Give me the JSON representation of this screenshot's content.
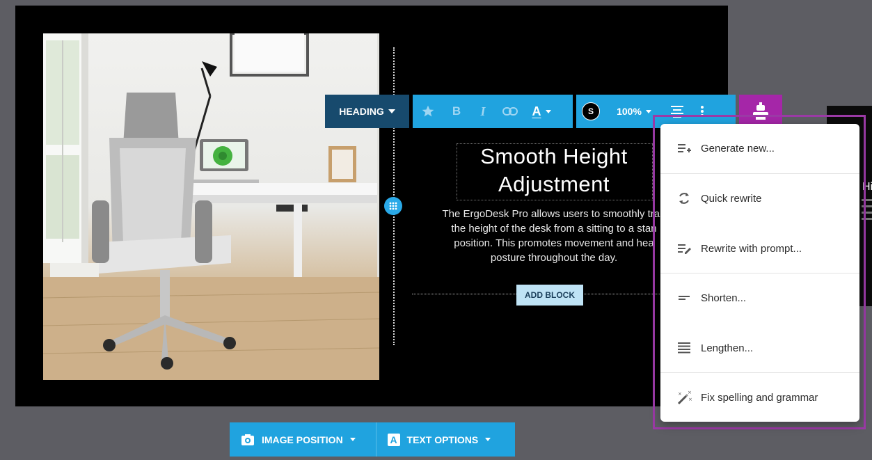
{
  "toolbar": {
    "heading_label": "HEADING",
    "font_letter": "S",
    "zoom": "100%"
  },
  "content": {
    "heading": "Smooth Height Adjustment",
    "body": "The ErgoDesk Pro allows users to smoothly tran\nthe height of the desk from a sitting to a stan\nposition. This promotes movement and hea\nposture throughout the day.",
    "add_block": "ADD BLOCK"
  },
  "ai_menu": {
    "items": [
      {
        "label": "Generate new...",
        "icon": "generate-icon"
      },
      {
        "label": "Quick rewrite",
        "icon": "refresh-icon"
      },
      {
        "label": "Rewrite with prompt...",
        "icon": "prompt-edit-icon"
      },
      {
        "label": "Shorten...",
        "icon": "shorten-icon"
      },
      {
        "label": "Lengthen...",
        "icon": "lengthen-icon"
      },
      {
        "label": "Fix spelling and grammar",
        "icon": "magic-wand-icon"
      }
    ]
  },
  "bottom_bar": {
    "image_position": "IMAGE POSITION",
    "text_options": "TEXT OPTIONS"
  },
  "peek": {
    "title": "Hi"
  },
  "colors": {
    "accent": "#20a3df",
    "heading_button": "#174a6d",
    "ai_button": "#a526a8",
    "highlight": "#9b3aa6"
  }
}
